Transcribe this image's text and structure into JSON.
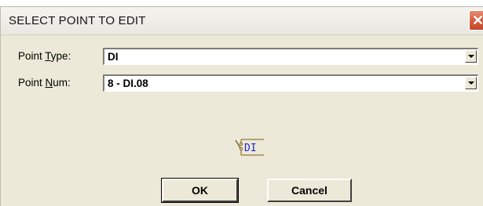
{
  "dialog": {
    "title": "SELECT POINT TO EDIT",
    "close_glyph": "✕"
  },
  "point_type": {
    "label_before": "Point ",
    "label_accel": "T",
    "label_after": "ype:",
    "value": "DI"
  },
  "point_num": {
    "label_before": "Point ",
    "label_accel": "N",
    "label_after": "um:",
    "value": "8 - DI.08"
  },
  "preview": {
    "icon": "digital-input-icon",
    "text": "DI"
  },
  "buttons": {
    "ok": "OK",
    "cancel": "Cancel"
  },
  "colors": {
    "dialog_bg": "#ece9d8",
    "close_button": "#d35c3d",
    "icon_text": "#2828c8",
    "icon_lines": "#7a5a10"
  }
}
